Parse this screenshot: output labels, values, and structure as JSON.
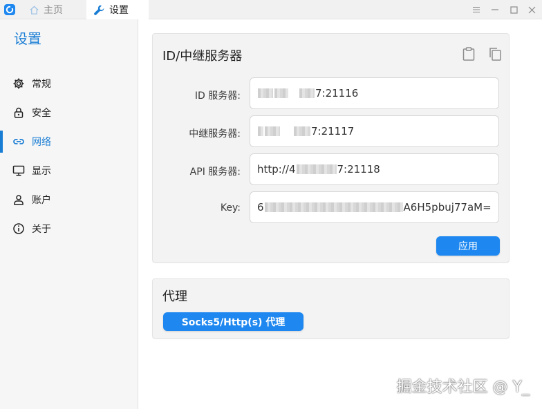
{
  "titlebar": {
    "tabs": [
      {
        "label": "主页",
        "icon": "home-icon"
      },
      {
        "label": "设置",
        "icon": "wrench-icon"
      }
    ],
    "controls": [
      "menu-icon",
      "minimize-icon",
      "maximize-icon",
      "close-icon"
    ]
  },
  "sidebar": {
    "title": "设置",
    "items": [
      {
        "label": "常规",
        "icon": "gear-icon"
      },
      {
        "label": "安全",
        "icon": "lock-icon"
      },
      {
        "label": "网络",
        "icon": "link-icon",
        "active": true
      },
      {
        "label": "显示",
        "icon": "monitor-icon"
      },
      {
        "label": "账户",
        "icon": "user-icon"
      },
      {
        "label": "关于",
        "icon": "info-icon"
      }
    ]
  },
  "server_card": {
    "title": "ID/中继服务器",
    "fields": [
      {
        "label": "ID 服务器:",
        "visible_value": "7:21116"
      },
      {
        "label": "中继服务器:",
        "visible_value": "7:21117"
      },
      {
        "label": "API 服务器:",
        "visible_prefix": "http://4",
        "visible_value": "7:21118"
      },
      {
        "label": "Key:",
        "visible_prefix": "6",
        "visible_value": "A6H5pbuj77aM="
      }
    ],
    "apply_label": "应用"
  },
  "proxy_card": {
    "title": "代理",
    "button_label": "Socks5/Http(s) 代理"
  },
  "watermark": "掘金技术社区 @ Y_",
  "colors": {
    "accent": "#1a7dd4",
    "button": "#1e88f0"
  }
}
